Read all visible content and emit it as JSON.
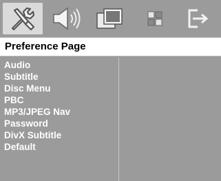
{
  "toolbar": {
    "icons": [
      {
        "name": "general-setup-icon",
        "selected": true
      },
      {
        "name": "audio-setup-icon",
        "selected": false
      },
      {
        "name": "video-setup-icon",
        "selected": false
      },
      {
        "name": "preference-setup-icon",
        "selected": false
      },
      {
        "name": "exit-icon",
        "selected": false
      }
    ]
  },
  "header": {
    "title": "Preference Page"
  },
  "menu": {
    "items": [
      "Audio",
      "Subtitle",
      "Disc Menu",
      "PBC",
      "MP3/JPEG Nav",
      "Password",
      "DivX Subtitle",
      "Default"
    ]
  },
  "colors": {
    "panel_background": "#9b9b9b",
    "selected_tab": "#dadada",
    "header_background": "#ffffff",
    "item_text": "#ffffff"
  }
}
